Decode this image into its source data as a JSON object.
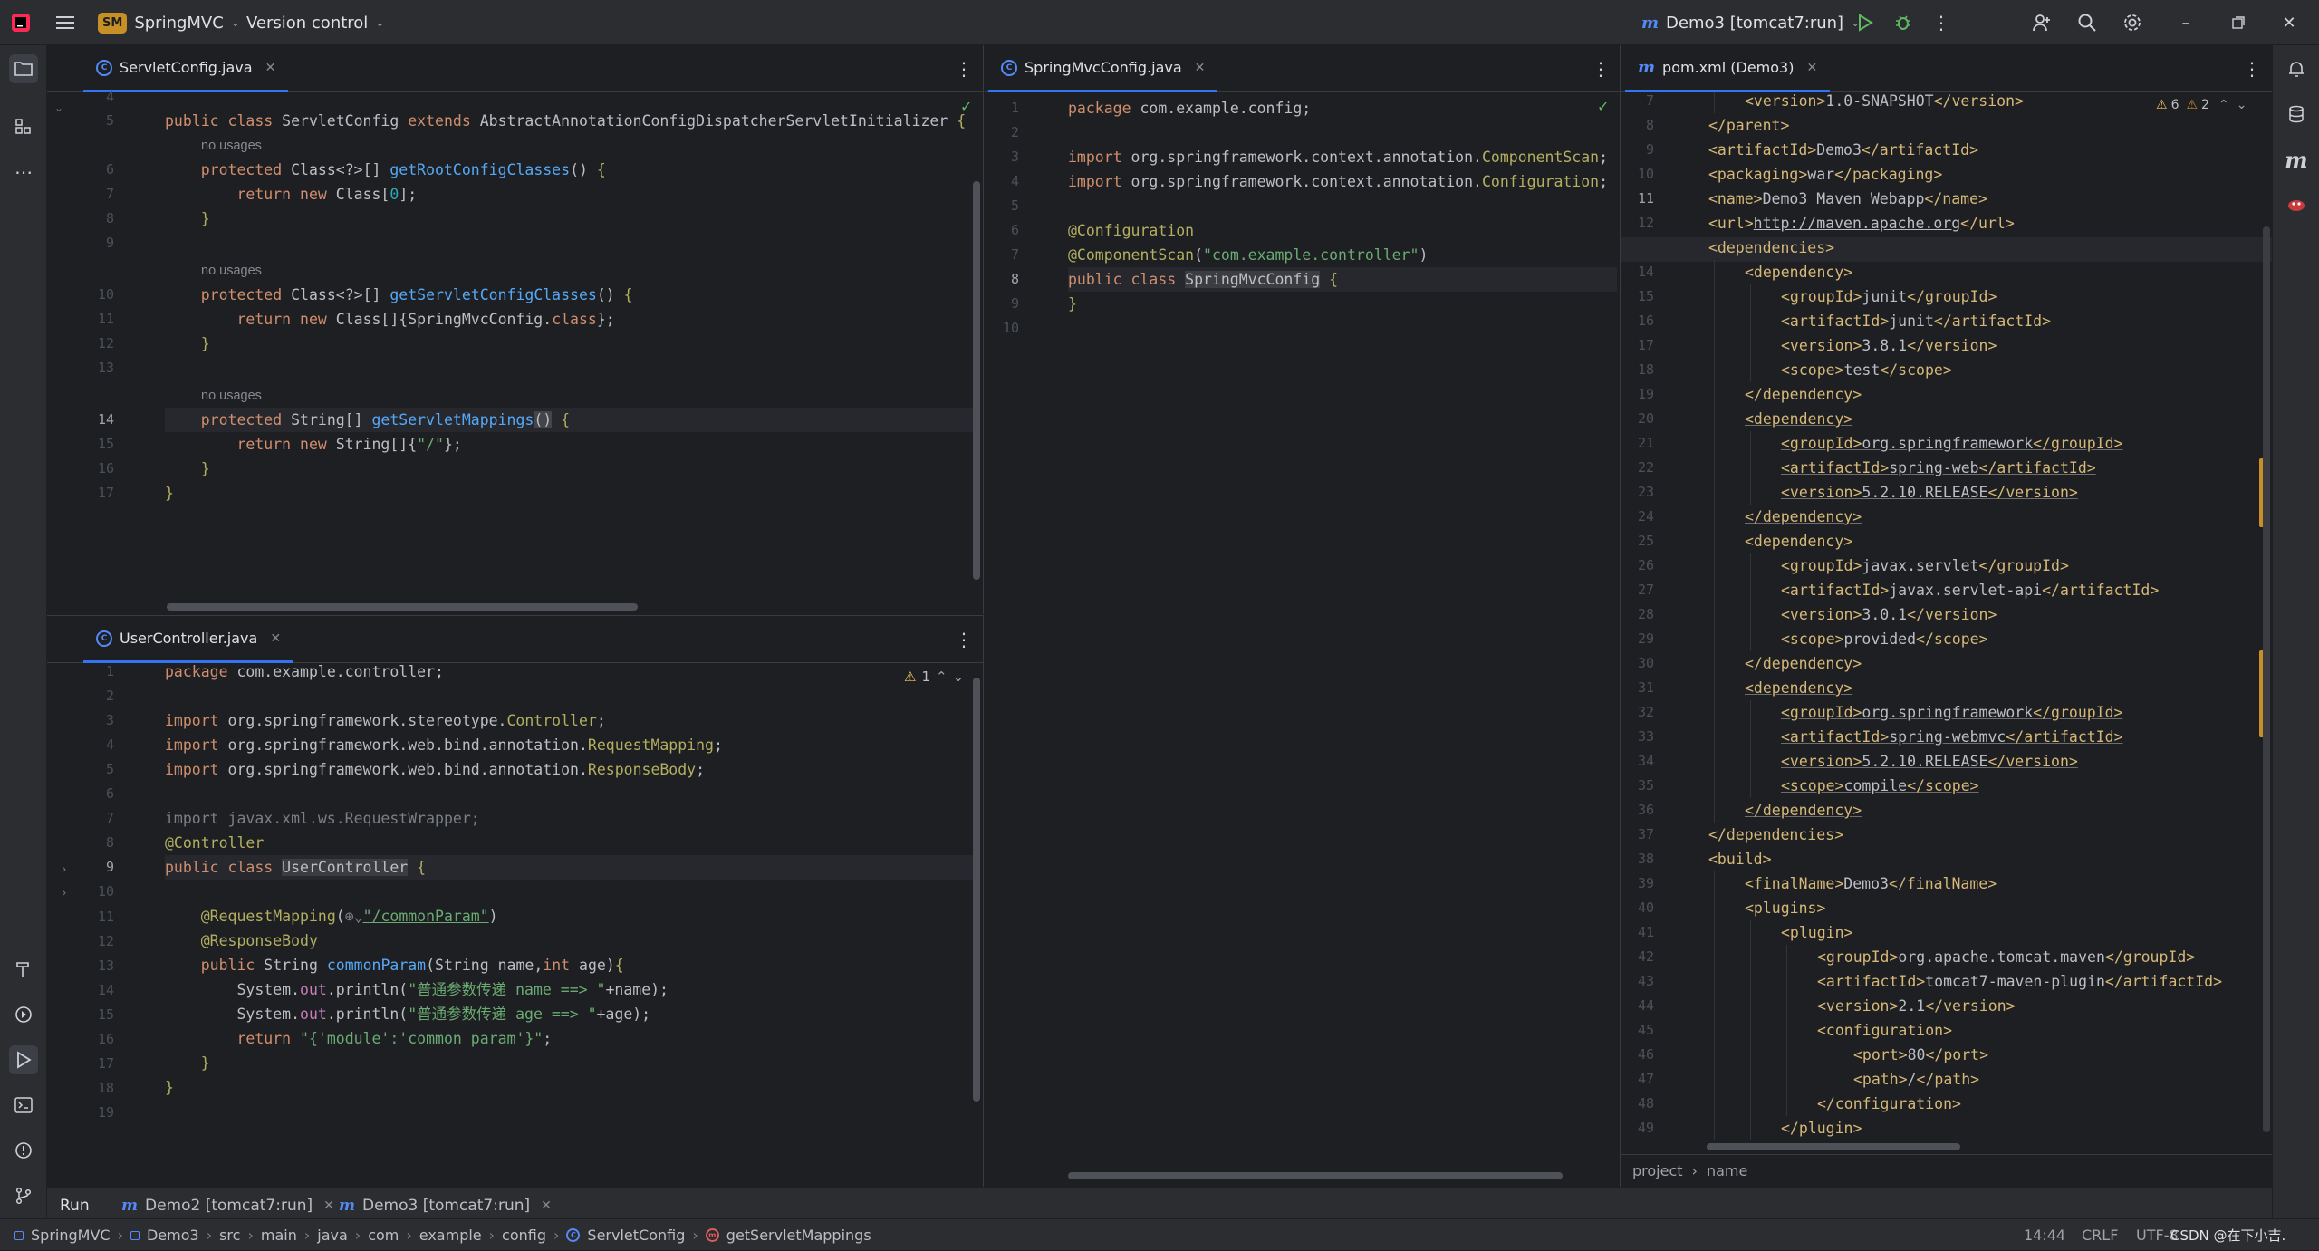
{
  "titlebar": {
    "project_badge": "SM",
    "project_name": "SpringMVC",
    "version_control": "Version control",
    "run_config": "Demo3 [tomcat7:run]"
  },
  "panes": {
    "servlet_config": {
      "tab": "ServletConfig.java",
      "lines": [
        "4",
        "5",
        "",
        "6",
        "7",
        "8",
        "9",
        "",
        "10",
        "11",
        "12",
        "13",
        "",
        "14",
        "15",
        "16",
        "17"
      ]
    },
    "user_controller": {
      "tab": "UserController.java",
      "warning_count": "1",
      "lines": [
        "1",
        "2",
        "3",
        "4",
        "5",
        "6",
        "7",
        "8",
        "9",
        "10",
        "11",
        "12",
        "13",
        "14",
        "15",
        "16",
        "17",
        "18",
        "19"
      ]
    },
    "springmvc_config": {
      "tab": "SpringMvcConfig.java",
      "lines": [
        "1",
        "2",
        "3",
        "4",
        "5",
        "6",
        "7",
        "8",
        "9",
        "10"
      ]
    },
    "pom": {
      "tab": "pom.xml (Demo3)",
      "warn_count": "6",
      "weak_warn_count": "2",
      "lines": [
        "7",
        "8",
        "9",
        "10",
        "11",
        "12",
        "13",
        "14",
        "15",
        "16",
        "17",
        "18",
        "19",
        "20",
        "21",
        "22",
        "23",
        "24",
        "25",
        "26",
        "27",
        "28",
        "29",
        "30",
        "31",
        "32",
        "33",
        "34",
        "35",
        "36",
        "37",
        "38",
        "39",
        "40",
        "41",
        "42",
        "43",
        "44",
        "45",
        "46",
        "47",
        "48",
        "49"
      ],
      "breadcrumb": [
        "project",
        "name"
      ]
    }
  },
  "bottom": {
    "run_label": "Run",
    "tabs": [
      "Demo2 [tomcat7:run]",
      "Demo3 [tomcat7:run]"
    ]
  },
  "status": {
    "breadcrumb": [
      "SpringMVC",
      "Demo3",
      "src",
      "main",
      "java",
      "com",
      "example",
      "config",
      "ServletConfig",
      "getServletMappings"
    ],
    "position": "14:44",
    "line_sep": "CRLF",
    "encoding": "UTF-8",
    "watermark": "CSDN @在下小吉."
  },
  "colors": {
    "accent": "#3574f0",
    "keyword": "#cf8e6d",
    "function": "#56a8f5",
    "string": "#6aab73",
    "annotation": "#b3ae60",
    "xml_tag": "#d5b778"
  }
}
